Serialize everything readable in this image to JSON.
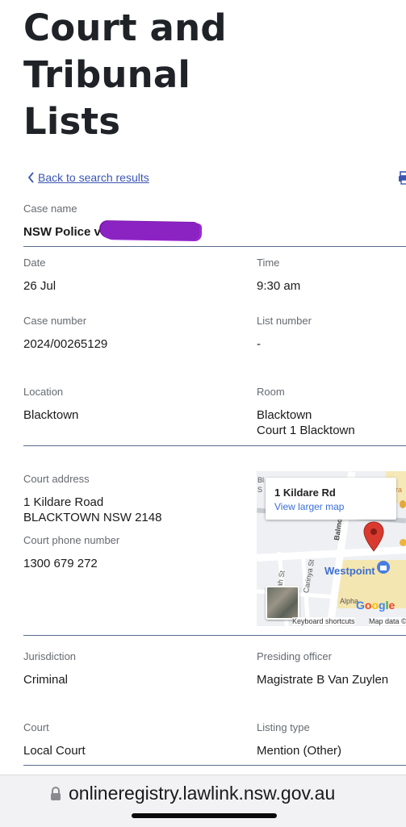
{
  "page": {
    "title_lines": [
      "Court and",
      "Tribunal",
      "Lists"
    ],
    "back_link": "Back to search results"
  },
  "case": {
    "case_name_label": "Case name",
    "case_name_value": "NSW Police v D",
    "date_label": "Date",
    "date_value": "26 Jul",
    "time_label": "Time",
    "time_value": "9:30 am",
    "case_number_label": "Case number",
    "case_number_value": "2024/00265129",
    "list_number_label": "List number",
    "list_number_value": "-",
    "location_label": "Location",
    "location_value": "Blacktown",
    "room_label": "Room",
    "room_value_line1": "Blacktown",
    "room_value_line2": "Court 1 Blacktown",
    "court_address_label": "Court address",
    "court_address_line1": "1 Kildare Road",
    "court_address_line2": "BLACKTOWN NSW 2148",
    "court_phone_label": "Court phone number",
    "court_phone_value": "1300 679 272",
    "jurisdiction_label": "Jurisdiction",
    "jurisdiction_value": "Criminal",
    "presiding_label": "Presiding officer",
    "presiding_value": "Magistrate B Van Zuylen",
    "court_label": "Court",
    "court_value": "Local Court",
    "listing_type_label": "Listing type",
    "listing_type_value": "Mention (Other)"
  },
  "map": {
    "card_title": "1 Kildare Rd",
    "card_link": "View larger map",
    "street_balmoral": "Balmoral St",
    "street_carinya": "Carinya St",
    "street_ivah": "Ivah St",
    "place_westpoint": "Westpoint",
    "place_alpha": "Alpha",
    "attribution_google": "Google",
    "keyboard_shortcuts": "Keyboard shortcuts",
    "map_data": "Map data ©",
    "partial_label_tl": "Bl",
    "partial_label_tr": "ra",
    "partial_label_s": "S"
  },
  "browser": {
    "url": "onlineregistry.lawlink.nsw.gov.au"
  },
  "colors": {
    "link": "#3b55b3",
    "divider": "#5a6c8f",
    "redaction": "#8b22c2",
    "map_pin": "#d93a30"
  }
}
